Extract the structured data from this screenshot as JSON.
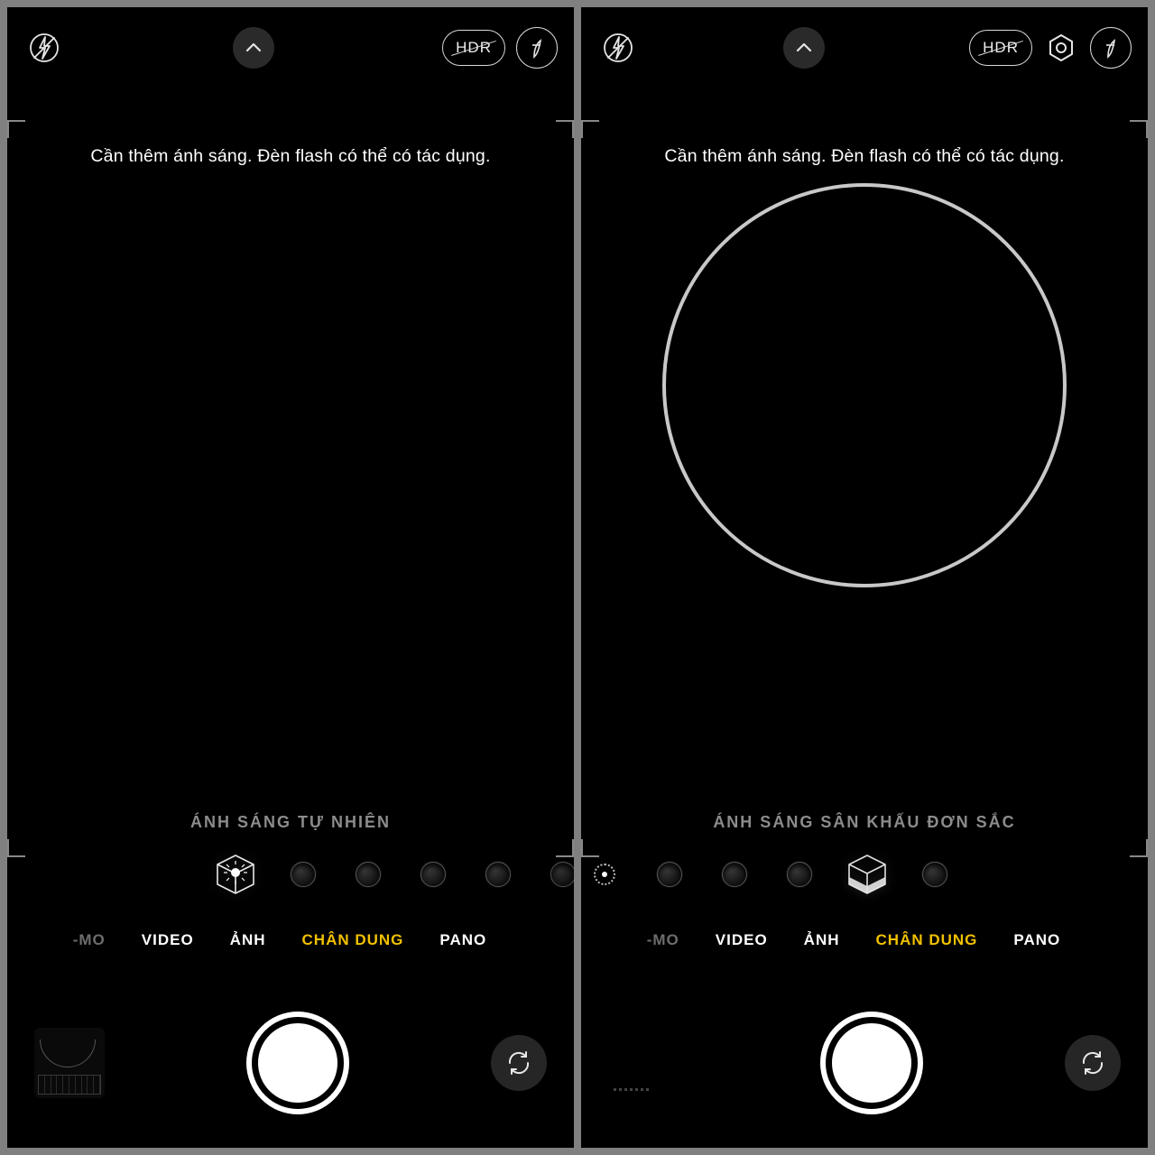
{
  "left": {
    "hdr_label": "HDR",
    "hint": "Cần thêm ánh sáng. Đèn flash có thể có tác dụng.",
    "lighting_label": "ÁNH SÁNG TỰ NHIÊN",
    "modes": {
      "clip": "-MO",
      "video": "VIDEO",
      "photo": "ẢNH",
      "portrait": "CHÂN DUNG",
      "pano": "PANO"
    }
  },
  "right": {
    "hdr_label": "HDR",
    "hint": "Cần thêm ánh sáng. Đèn flash có thể có tác dụng.",
    "lighting_label": "ÁNH SÁNG SÂN KHẤU ĐƠN SẮC",
    "modes": {
      "clip": "-MO",
      "video": "VIDEO",
      "photo": "ẢNH",
      "portrait": "CHÂN DUNG",
      "pano": "PANO"
    }
  }
}
